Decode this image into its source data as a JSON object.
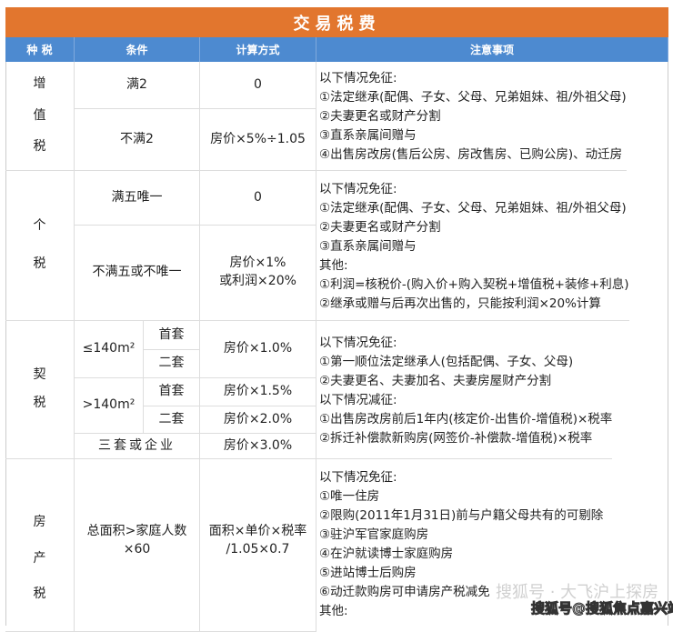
{
  "title": "交易税费",
  "headers": [
    "种 税",
    "条件",
    "计算方式",
    "注意事项"
  ],
  "vat": {
    "name": [
      "增",
      "值",
      "税"
    ],
    "rows": [
      {
        "cond": "满2",
        "calc": "0"
      },
      {
        "cond": "不满2",
        "calc": "房价×5%÷1.05"
      }
    ],
    "notes": [
      "以下情况免征:",
      "①法定继承(配偶、子女、父母、兄弟姐妹、祖/外祖父母)",
      "②夫妻更名或财产分割",
      "③直系亲属间赠与",
      "④出售房改房(售后公房、房改售房、已购公房)、动迁房"
    ]
  },
  "iit": {
    "name": [
      "个",
      "税"
    ],
    "rows": [
      {
        "cond": "满五唯一",
        "calc": "0"
      },
      {
        "cond": "不满五或不唯一",
        "calc1": "房价×1%",
        "calc2": "或利润×20%"
      }
    ],
    "notes": [
      "以下情况免征:",
      "①法定继承(配偶、子女、父母、兄弟姐妹、祖/外祖父母)",
      "②夫妻更名或财产分割",
      "③直系亲属间赠与",
      "其他:",
      "①利润=核税价-(购入价+购入契税+增值税+装修+利息)",
      "②继承或赠与后再次出售的，只能按利润×20%计算"
    ]
  },
  "deed": {
    "name": [
      "契",
      "税"
    ],
    "small": "≤140m²",
    "large": ">140m²",
    "first": "首套",
    "second": "二套",
    "calc_small": "房价×1.0%",
    "calc_large_first": "房价×1.5%",
    "calc_large_second": "房价×2.0%",
    "third": "三套或企业",
    "calc_third": "房价×3.0%",
    "notes": [
      "以下情况免征:",
      "①第一顺位法定继承人(包括配偶、子女、父母)",
      "②夫妻更名、夫妻加名、夫妻房屋财产分割",
      "以下情况减征:",
      "①出售房改房前后1年内(核定价-出售价-增值税)×税率",
      "②拆迁补偿款新购房(网签价-补偿款-增值税)×税率"
    ]
  },
  "property": {
    "name": [
      "房",
      "产",
      "税"
    ],
    "cond1": "总面积>家庭人数",
    "cond2": "×60",
    "calc1": "面积×单价×税率",
    "calc2": "/1.05×0.7",
    "notes": [
      "以下情况免征:",
      "①唯一住房",
      "②限购(2011年1月31日)前与户籍父母共有的可剔除",
      "③驻沪军官家庭购房",
      "④在沪就读博士家庭购房",
      "⑤进站博士后购房",
      "⑥动迁款购房可申请房产税减免",
      "其他:"
    ]
  },
  "watermark": {
    "faint": "搜狐号 · 大飞沪上探房",
    "main": "搜狐号@搜狐焦点嘉兴站"
  }
}
